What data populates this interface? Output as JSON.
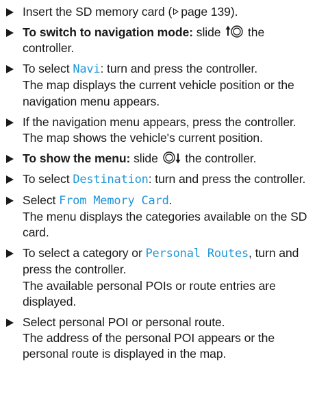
{
  "steps": [
    {
      "pre": "Insert the SD memory card (",
      "ref": "page 139",
      "post": ")."
    },
    {
      "bold": "To switch to navigation mode:",
      "pre": " slide ",
      "icon": "slide-up-controller-icon",
      "post": " the controller."
    },
    {
      "pre": "To select ",
      "ui": "Navi",
      "post": ": turn and press the controller.",
      "result": "The map displays the current vehicle position or the navigation menu appears."
    },
    {
      "pre": "If the navigation menu appears, press the controller.",
      "result": "The map shows the vehicle's current position."
    },
    {
      "bold": "To show the menu:",
      "pre": " slide ",
      "icon": "slide-down-controller-icon",
      "post": " the controller."
    },
    {
      "pre": "To select ",
      "ui": "Destination",
      "post": ": turn and press the controller."
    },
    {
      "pre": "Select ",
      "ui": "From Memory Card",
      "post": ".",
      "result": "The menu displays the categories available on the SD card."
    },
    {
      "pre": "To select a category or ",
      "ui": "Personal Routes",
      "post": ", turn and press the controller.",
      "result": "The available personal POIs or route entries are displayed."
    },
    {
      "pre": "Select personal POI or personal route.",
      "result": "The address of the personal POI appears or the personal route is displayed in the map."
    }
  ],
  "colors": {
    "ui_text": "#1e96d9",
    "body_text": "#1a1a1a"
  }
}
